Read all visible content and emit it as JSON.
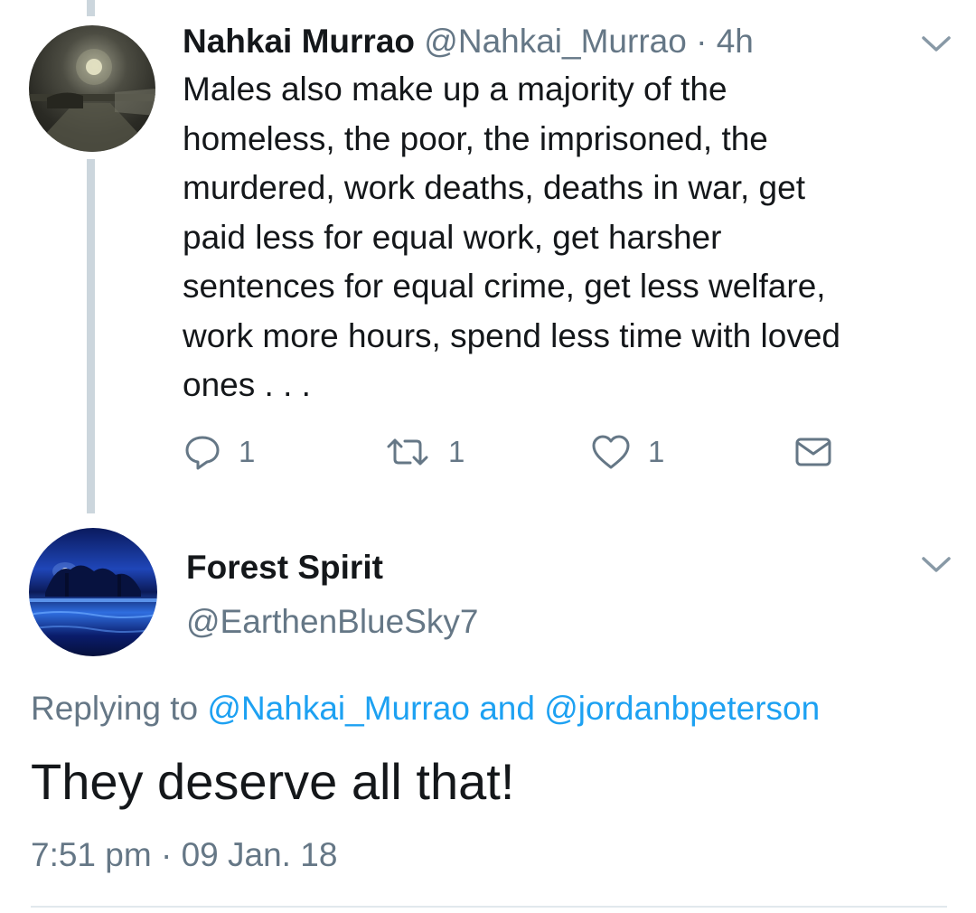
{
  "tweet1": {
    "author_name": "Nahkai Murrao",
    "author_handle": "@Nahkai_Murrao",
    "separator": "·",
    "time": "4h",
    "body_lines": [
      "Males also make up a majority of the",
      "homeless, the poor, the imprisoned, the",
      "murdered, work deaths, deaths in war, get",
      "paid less for equal work, get harsher",
      "sentences for equal crime, get less welfare,",
      "work more hours, spend less time with loved",
      "ones . . ."
    ],
    "actions": {
      "reply_count": "1",
      "retweet_count": "1",
      "like_count": "1"
    }
  },
  "tweet2": {
    "author_name": "Forest Spirit",
    "author_handle": "@EarthenBlueSky7",
    "replying_prefix": "Replying to",
    "replying_mention_1": "@Nahkai_Murrao",
    "replying_and": "and",
    "replying_mention_2": "@jordanbpeterson",
    "text": "They deserve all that!",
    "time": "7:51 pm",
    "separator": "·",
    "date": "09 Jan. 18"
  },
  "icons": {
    "menu": "chevron-down-icon",
    "reply": "reply-icon",
    "retweet": "retweet-icon",
    "like": "heart-icon",
    "dm": "envelope-icon"
  },
  "colors": {
    "text": "#14171a",
    "secondary": "#657786",
    "link": "#1da1f2",
    "thread_line": "#ccd6dd",
    "divider": "#e1e8ed"
  }
}
